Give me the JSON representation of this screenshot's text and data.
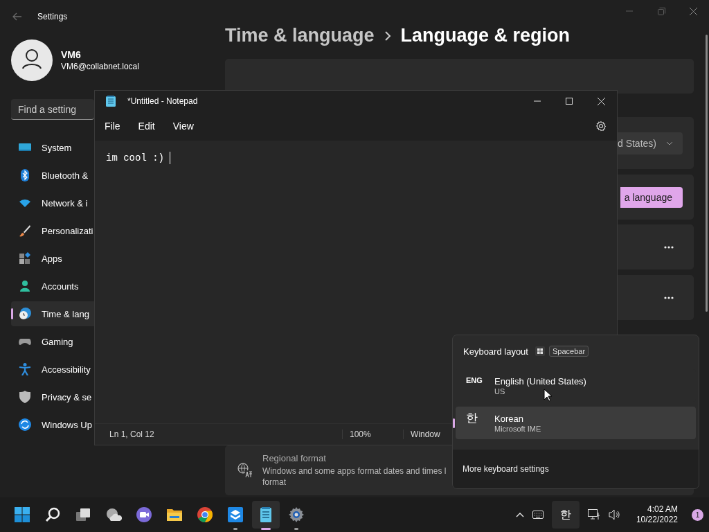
{
  "settings": {
    "title": "Settings",
    "user": {
      "name": "VM6",
      "email": "VM6@collabnet.local"
    },
    "search": {
      "placeholder": "Find a setting"
    },
    "nav": [
      {
        "label": "System",
        "kind": "system",
        "selected": false
      },
      {
        "label": "Bluetooth &",
        "kind": "bluetooth",
        "selected": false
      },
      {
        "label": "Network & i",
        "kind": "network",
        "selected": false
      },
      {
        "label": "Personalizati",
        "kind": "brush",
        "selected": false
      },
      {
        "label": "Apps",
        "kind": "apps",
        "selected": false
      },
      {
        "label": "Accounts",
        "kind": "accounts",
        "selected": false
      },
      {
        "label": "Time & lang",
        "kind": "time",
        "selected": true
      },
      {
        "label": "Gaming",
        "kind": "gaming",
        "selected": false
      },
      {
        "label": "Accessibility",
        "kind": "accessibility",
        "selected": false
      },
      {
        "label": "Privacy & se",
        "kind": "privacy",
        "selected": false
      },
      {
        "label": "Windows Up",
        "kind": "update",
        "selected": false
      }
    ],
    "breadcrumb": {
      "parent": "Time & language",
      "current": "Language & region"
    },
    "cards": [
      {
        "kind": "blank"
      },
      {
        "kind": "dropdown",
        "value": "d States)"
      },
      {
        "kind": "button",
        "label": "a language"
      },
      {
        "kind": "more"
      },
      {
        "kind": "more"
      },
      {
        "kind": "info",
        "title": "Regional format",
        "description_lines": [
          "Windows and some apps format dates and times l",
          "format"
        ]
      }
    ]
  },
  "notepad": {
    "title": "*Untitled - Notepad",
    "menu": [
      "File",
      "Edit",
      "View"
    ],
    "text": "im cool :)",
    "status": [
      "Ln 1, Col 12",
      "100%",
      "Window"
    ]
  },
  "keyboard_flyout": {
    "title": "Keyboard layout",
    "shortcut": "Spacebar",
    "layouts": [
      {
        "code": "ENG",
        "name": "English (United States)",
        "detail": "US",
        "selected": false
      },
      {
        "code": "한",
        "name": "Korean",
        "detail": "Microsoft IME",
        "selected": true
      }
    ],
    "footer": "More keyboard settings"
  },
  "taskbar": {
    "apps": [
      {
        "kind": "start",
        "running": false,
        "active": false
      },
      {
        "kind": "search",
        "running": false,
        "active": false
      },
      {
        "kind": "taskview",
        "running": false,
        "active": false
      },
      {
        "kind": "weather",
        "running": false,
        "active": false
      },
      {
        "kind": "chat",
        "running": false,
        "active": false
      },
      {
        "kind": "explorer",
        "running": false,
        "active": false
      },
      {
        "kind": "chrome",
        "running": false,
        "active": false
      },
      {
        "kind": "box",
        "running": true,
        "active": false
      },
      {
        "kind": "notepad",
        "running": true,
        "active": true
      },
      {
        "kind": "settings",
        "running": true,
        "active": false
      }
    ],
    "tray": {
      "ime": "한",
      "time": "4:02 AM",
      "date": "10/22/2022",
      "notifications": "1"
    }
  }
}
